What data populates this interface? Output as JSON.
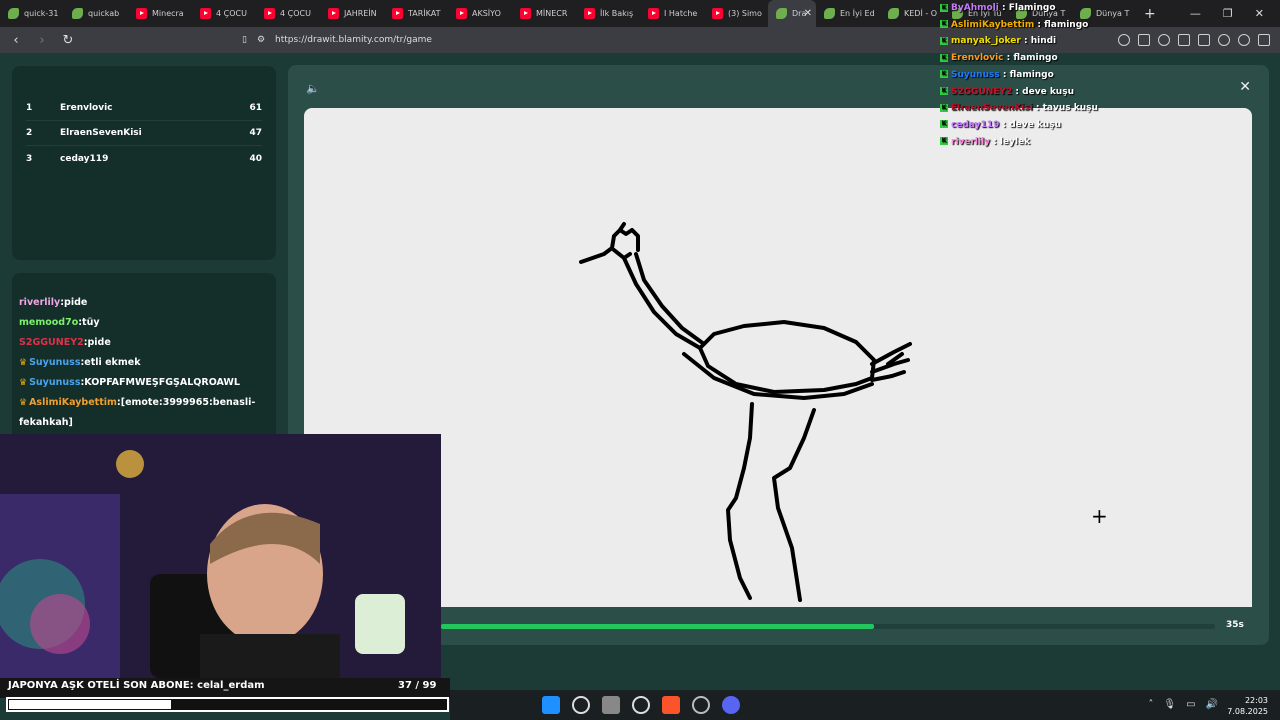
{
  "browser": {
    "tabs": [
      {
        "label": "quick-31",
        "fav": "leaf"
      },
      {
        "label": "quickab",
        "fav": "leaf"
      },
      {
        "label": "Minecra",
        "fav": "yt"
      },
      {
        "label": "4 ÇOCU",
        "fav": "yt"
      },
      {
        "label": "4 ÇOCU",
        "fav": "yt"
      },
      {
        "label": "JAHREİN",
        "fav": "yt"
      },
      {
        "label": "TARİKAT",
        "fav": "yt"
      },
      {
        "label": "AKSİYO",
        "fav": "yt"
      },
      {
        "label": "MİNECR",
        "fav": "yt"
      },
      {
        "label": "İlk Bakış",
        "fav": "yt"
      },
      {
        "label": "I Hatche",
        "fav": "yt"
      },
      {
        "label": "(3) Simo",
        "fav": "yt"
      }
    ],
    "active_tab": {
      "label": "Dra",
      "fav": "leaf"
    },
    "tabs_after": [
      {
        "label": "En İyi Ed",
        "fav": "leaf"
      },
      {
        "label": "KEDİ - O",
        "fav": "leaf"
      },
      {
        "label": "En İyi Tü",
        "fav": "leaf"
      },
      {
        "label": "Dünya T",
        "fav": "leaf"
      },
      {
        "label": "Dünya T",
        "fav": "leaf"
      }
    ],
    "url": "https://drawit.blamity.com/tr/game"
  },
  "leaderboard": [
    {
      "rank": "1",
      "name": "Erenvlovic",
      "score": "61"
    },
    {
      "rank": "2",
      "name": "ElraenSevenKisi",
      "score": "47"
    },
    {
      "rank": "3",
      "name": "ceday119",
      "score": "40"
    }
  ],
  "game_chat": [
    {
      "user": "riverlily",
      "text": ":pide",
      "color": "#f0a6e6",
      "crown": false
    },
    {
      "user": "memood7o",
      "text": ":tüy",
      "color": "#7cf06a",
      "crown": false
    },
    {
      "user": "S2GGUNEY2",
      "text": ":pide",
      "color": "#e0304a",
      "crown": false
    },
    {
      "user": "Suyunuss",
      "text": ":etli ekmek",
      "color": "#4aa3f0",
      "crown": true
    },
    {
      "user": "Suyunuss",
      "text": ":KOPFAFMWEŞFGŞALQROAWL",
      "color": "#4aa3f0",
      "crown": true
    },
    {
      "user": "AslimiKaybettim",
      "text": ":[emote:3999965:benasli-fekahkah]",
      "color": "#f0a030",
      "crown": true
    }
  ],
  "game": {
    "timer_label": "35s",
    "timer_progress": 0.56
  },
  "overlay_chat": [
    {
      "user": "ByAhmoli",
      "text": " : Flamingo",
      "color": "#c67bff"
    },
    {
      "user": "AslimiKaybettim",
      "text": " : flamingo",
      "color": "#f0b000"
    },
    {
      "user": "manyak_joker",
      "text": " : hindi",
      "color": "#f0e000"
    },
    {
      "user": "Erenvlovic",
      "text": " : flamingo",
      "color": "#ff9a1a"
    },
    {
      "user": "Suyunuss",
      "text": " : flamingo",
      "color": "#1e7bff"
    },
    {
      "user": "S2GGUNEY2",
      "text": " : deve kuşu",
      "color": "#d0102a"
    },
    {
      "user": "ElraenSevenKisi",
      "text": " : tavus kuşu",
      "color": "#c0102a"
    },
    {
      "user": "ceday119",
      "text": " : deve kuşu",
      "color": "#c67bff"
    },
    {
      "user": "riverlily",
      "text": " : leylek",
      "color": "#ff88dd"
    }
  ],
  "stream": {
    "ticker": "JAPONYA AŞK OTELİ   SON ABONE: celal_erdam",
    "sub_count": "37  / 99",
    "sub_progress": 0.37
  },
  "taskbar": {
    "time": "22:03",
    "date": "7.08.2025"
  },
  "colors": {
    "accent_green": "#22c55e",
    "panel": "#142e2a",
    "modal": "#2b4e49"
  }
}
